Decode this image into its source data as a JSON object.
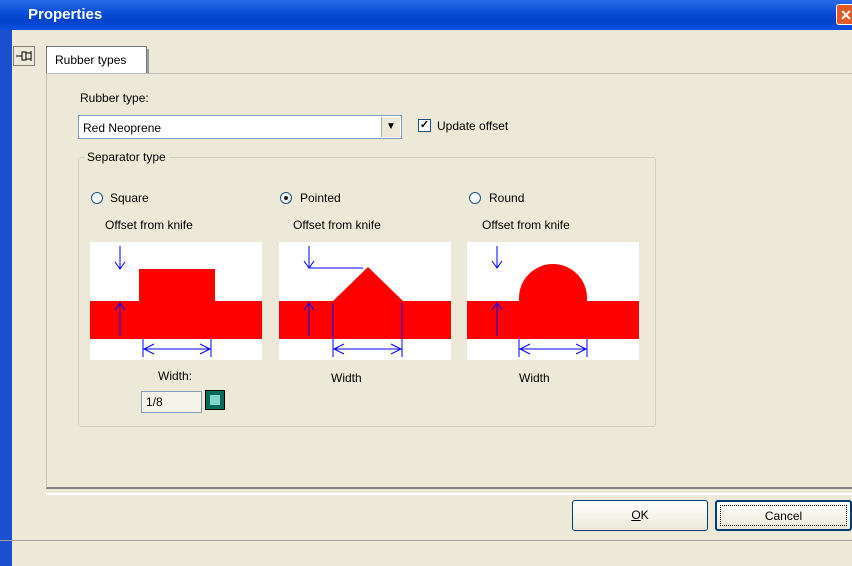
{
  "window": {
    "title": "Properties",
    "close_symbol": "✕"
  },
  "tabs": [
    {
      "label": "Rubber types",
      "active": true
    }
  ],
  "rubber_type": {
    "label": "Rubber type:",
    "value": "Red Neoprene"
  },
  "update_offset": {
    "label": "Update offset",
    "checked": true
  },
  "separator_group": {
    "legend": "Separator type",
    "options": [
      {
        "label": "Square",
        "selected": false,
        "offset_label": "Offset from knife",
        "width_label": "Width:"
      },
      {
        "label": "Pointed",
        "selected": true,
        "offset_label": "Offset from knife",
        "width_label": "Width"
      },
      {
        "label": "Round",
        "selected": false,
        "offset_label": "Offset from knife",
        "width_label": "Width"
      }
    ],
    "width_value": "1/8"
  },
  "buttons": {
    "ok": "OK",
    "cancel": "Cancel"
  },
  "colors": {
    "rubber": "#ff0000",
    "dimension": "#0000ff",
    "title_bar": "#0a4fd8"
  },
  "icons": {
    "pin": "pin-icon",
    "calculator": "calculator-icon",
    "close": "close-icon",
    "dropdown": "chevron-down-icon"
  }
}
